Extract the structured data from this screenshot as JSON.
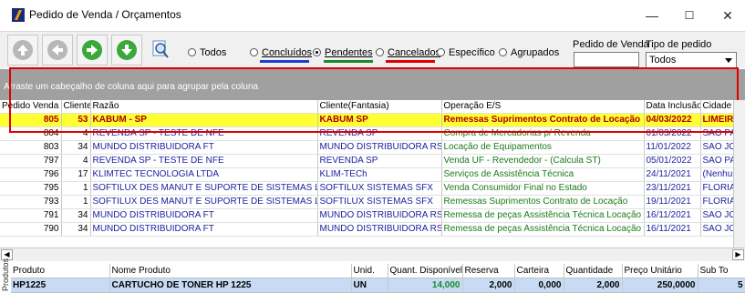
{
  "window": {
    "title": "Pedido de Venda / Orçamentos",
    "minimize": "—",
    "maximize": "☐",
    "close": "✕"
  },
  "filters": {
    "todos": "Todos",
    "concluidos": "Concluídos",
    "pendentes": "Pendentes",
    "cancelados": "Cancelados",
    "especifico": "Específico",
    "agrupados": "Agrupados",
    "selected": "Pendentes"
  },
  "pedido_label": "Pedido de Venda",
  "pedido_value": "",
  "tipo_label": "Tipo de pedido",
  "tipo_value": "Todos",
  "group_hint": "Arraste um cabeçalho de coluna aqui para agrupar pela coluna",
  "columns": [
    "Pedido Venda",
    "Cliente",
    "Razão",
    "Cliente(Fantasia)",
    "Operação E/S",
    "Data Inclusão",
    "Cidade"
  ],
  "rows": [
    {
      "pedido": "805",
      "cliente": "53",
      "razao": "KABUM - SP",
      "fantasia": "KABUM SP",
      "operacao": "Remessas  Suprimentos Contrato de Locação",
      "data": "04/03/2022",
      "cidade": "LIMEIR"
    },
    {
      "pedido": "804",
      "cliente": "4",
      "razao": "REVENDA SP - TESTE DE NFE",
      "fantasia": "REVENDA SP",
      "operacao": "Compra de Mercadorias p/ Revenda",
      "data": "01/03/2022",
      "cidade": "SAO PAU"
    },
    {
      "pedido": "803",
      "cliente": "34",
      "razao": "MUNDO DISTRIBUIDORA FT",
      "fantasia": "MUNDO DISTRIBUIDORA RS",
      "operacao": "Locação de Equipamentos",
      "data": "11/01/2022",
      "cidade": "SAO JOS"
    },
    {
      "pedido": "797",
      "cliente": "4",
      "razao": "REVENDA SP - TESTE DE NFE",
      "fantasia": "REVENDA SP",
      "operacao": "Venda UF - Revendedor - (Calcula ST)",
      "data": "05/01/2022",
      "cidade": "SAO PAU"
    },
    {
      "pedido": "796",
      "cliente": "17",
      "razao": "KLIMTEC TECNOLOGIA LTDA",
      "fantasia": "KLIM-TECh",
      "operacao": "Serviços de Assistência Técnica",
      "data": "24/11/2021",
      "cidade": "(Nenhur"
    },
    {
      "pedido": "795",
      "cliente": "1",
      "razao": "SOFTILUX DES MANUT E SUPORTE DE SISTEMAS LTDA ME",
      "fantasia": "SOFTILUX SISTEMAS SFX",
      "operacao": "Venda Consumidor Final no Estado",
      "data": "23/11/2021",
      "cidade": "FLORIAN"
    },
    {
      "pedido": "793",
      "cliente": "1",
      "razao": "SOFTILUX DES MANUT E SUPORTE DE SISTEMAS LTDA ME",
      "fantasia": "SOFTILUX SISTEMAS SFX",
      "operacao": "Remessas  Suprimentos Contrato de Locação",
      "data": "19/11/2021",
      "cidade": "FLORIAN"
    },
    {
      "pedido": "791",
      "cliente": "34",
      "razao": "MUNDO DISTRIBUIDORA FT",
      "fantasia": "MUNDO DISTRIBUIDORA RS",
      "operacao": "Remessa de peças Assistência Técnica Locação",
      "data": "16/11/2021",
      "cidade": "SAO JOS"
    },
    {
      "pedido": "790",
      "cliente": "34",
      "razao": "MUNDO DISTRIBUIDORA FT",
      "fantasia": "MUNDO DISTRIBUIDORA RS",
      "operacao": "Remessa de peças Assistência Técnica Locação",
      "data": "16/11/2021",
      "cidade": "SAO JOS"
    }
  ],
  "products_side_label": "Produtos",
  "product_columns": [
    "Produto",
    "Nome Produto",
    "Unid.",
    "Quant. Disponível",
    "Reserva",
    "Carteira",
    "Quantidade",
    "Preço Unitário",
    "Sub To"
  ],
  "products": [
    {
      "produto": "HP1225",
      "nome": "CARTUCHO DE TONER HP 1225",
      "unid": "UN",
      "disp": "14,000",
      "reserva": "2,000",
      "carteira": "0,000",
      "quantidade": "2,000",
      "preco": "250,0000",
      "sub": "5"
    }
  ],
  "colors": {
    "selected_row": "#ffff33",
    "selected_text": "#b00000",
    "red_frame": "#e00000",
    "concluidos_line": "#1a3fd0",
    "pendentes_line": "#1a8a2a",
    "cancelados_line": "#e00000"
  }
}
